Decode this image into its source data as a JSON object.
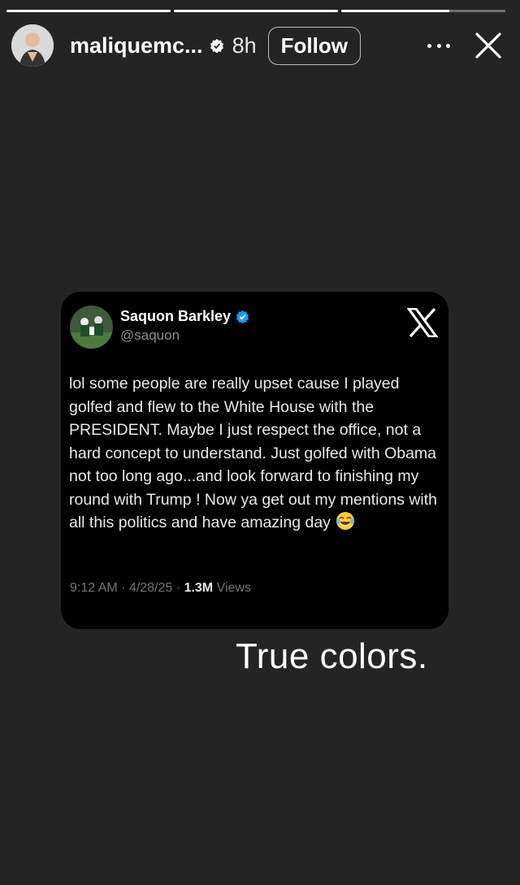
{
  "story": {
    "progress": [
      1,
      1,
      0.66
    ],
    "username": "maliquemc...",
    "time": "8h",
    "follow_label": "Follow",
    "icons": {
      "verified": "verified-badge-icon",
      "more": "more-options-icon",
      "close": "close-icon"
    }
  },
  "tweet": {
    "name": "Saquon Barkley",
    "handle": "@saquon",
    "text": "lol some people are really upset cause I played golfed and flew to the White House with the PRESIDENT. Maybe I just respect the office, not a hard concept to understand. Just golfed with Obama not too long ago...and look forward to finishing my round with Trump ! Now ya get out my mentions with all this politics and have amazing day",
    "emoji": "tears-of-joy-emoji",
    "time": "9:12 AM",
    "date": "4/28/25",
    "views_count": "1.3M",
    "views_label": "Views",
    "sep": "·",
    "colors": {
      "badge": "#1d9bf0",
      "background": "#000000"
    }
  },
  "caption": "True colors."
}
